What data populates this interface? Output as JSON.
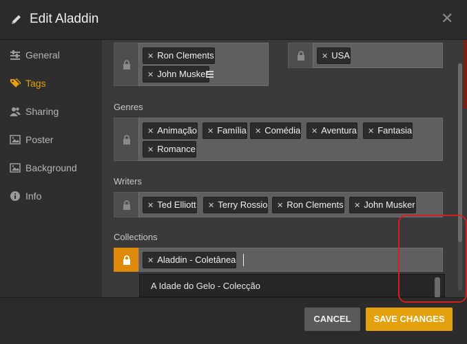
{
  "title": "Edit Aladdin",
  "sidebar": {
    "items": [
      {
        "label": "General",
        "icon": "sliders-icon"
      },
      {
        "label": "Tags",
        "icon": "tags-icon",
        "active": true
      },
      {
        "label": "Sharing",
        "icon": "users-icon"
      },
      {
        "label": "Poster",
        "icon": "image-icon"
      },
      {
        "label": "Background",
        "icon": "image-icon"
      },
      {
        "label": "Info",
        "icon": "info-icon"
      }
    ]
  },
  "top_fields": {
    "directors": [
      "Ron Clements",
      "John Musker"
    ],
    "countries": [
      "USA"
    ]
  },
  "genres": {
    "label": "Genres",
    "tags": [
      "Animação",
      "Família",
      "Comédia",
      "Aventura",
      "Fantasia",
      "Romance"
    ]
  },
  "writers": {
    "label": "Writers",
    "tags": [
      "Ted Elliott",
      "Terry Rossio",
      "Ron Clements",
      "John Musker"
    ]
  },
  "collections": {
    "label": "Collections",
    "tags": [
      "Aladdin - Coletânea"
    ],
    "suggestion": "A Idade do Gelo - Colecção"
  },
  "footer": {
    "cancel_label": "CANCEL",
    "save_label": "SAVE CHANGES"
  },
  "colors": {
    "accent": "#e5a00d",
    "background": "#3a3a3a",
    "annotation": "#d62020"
  }
}
